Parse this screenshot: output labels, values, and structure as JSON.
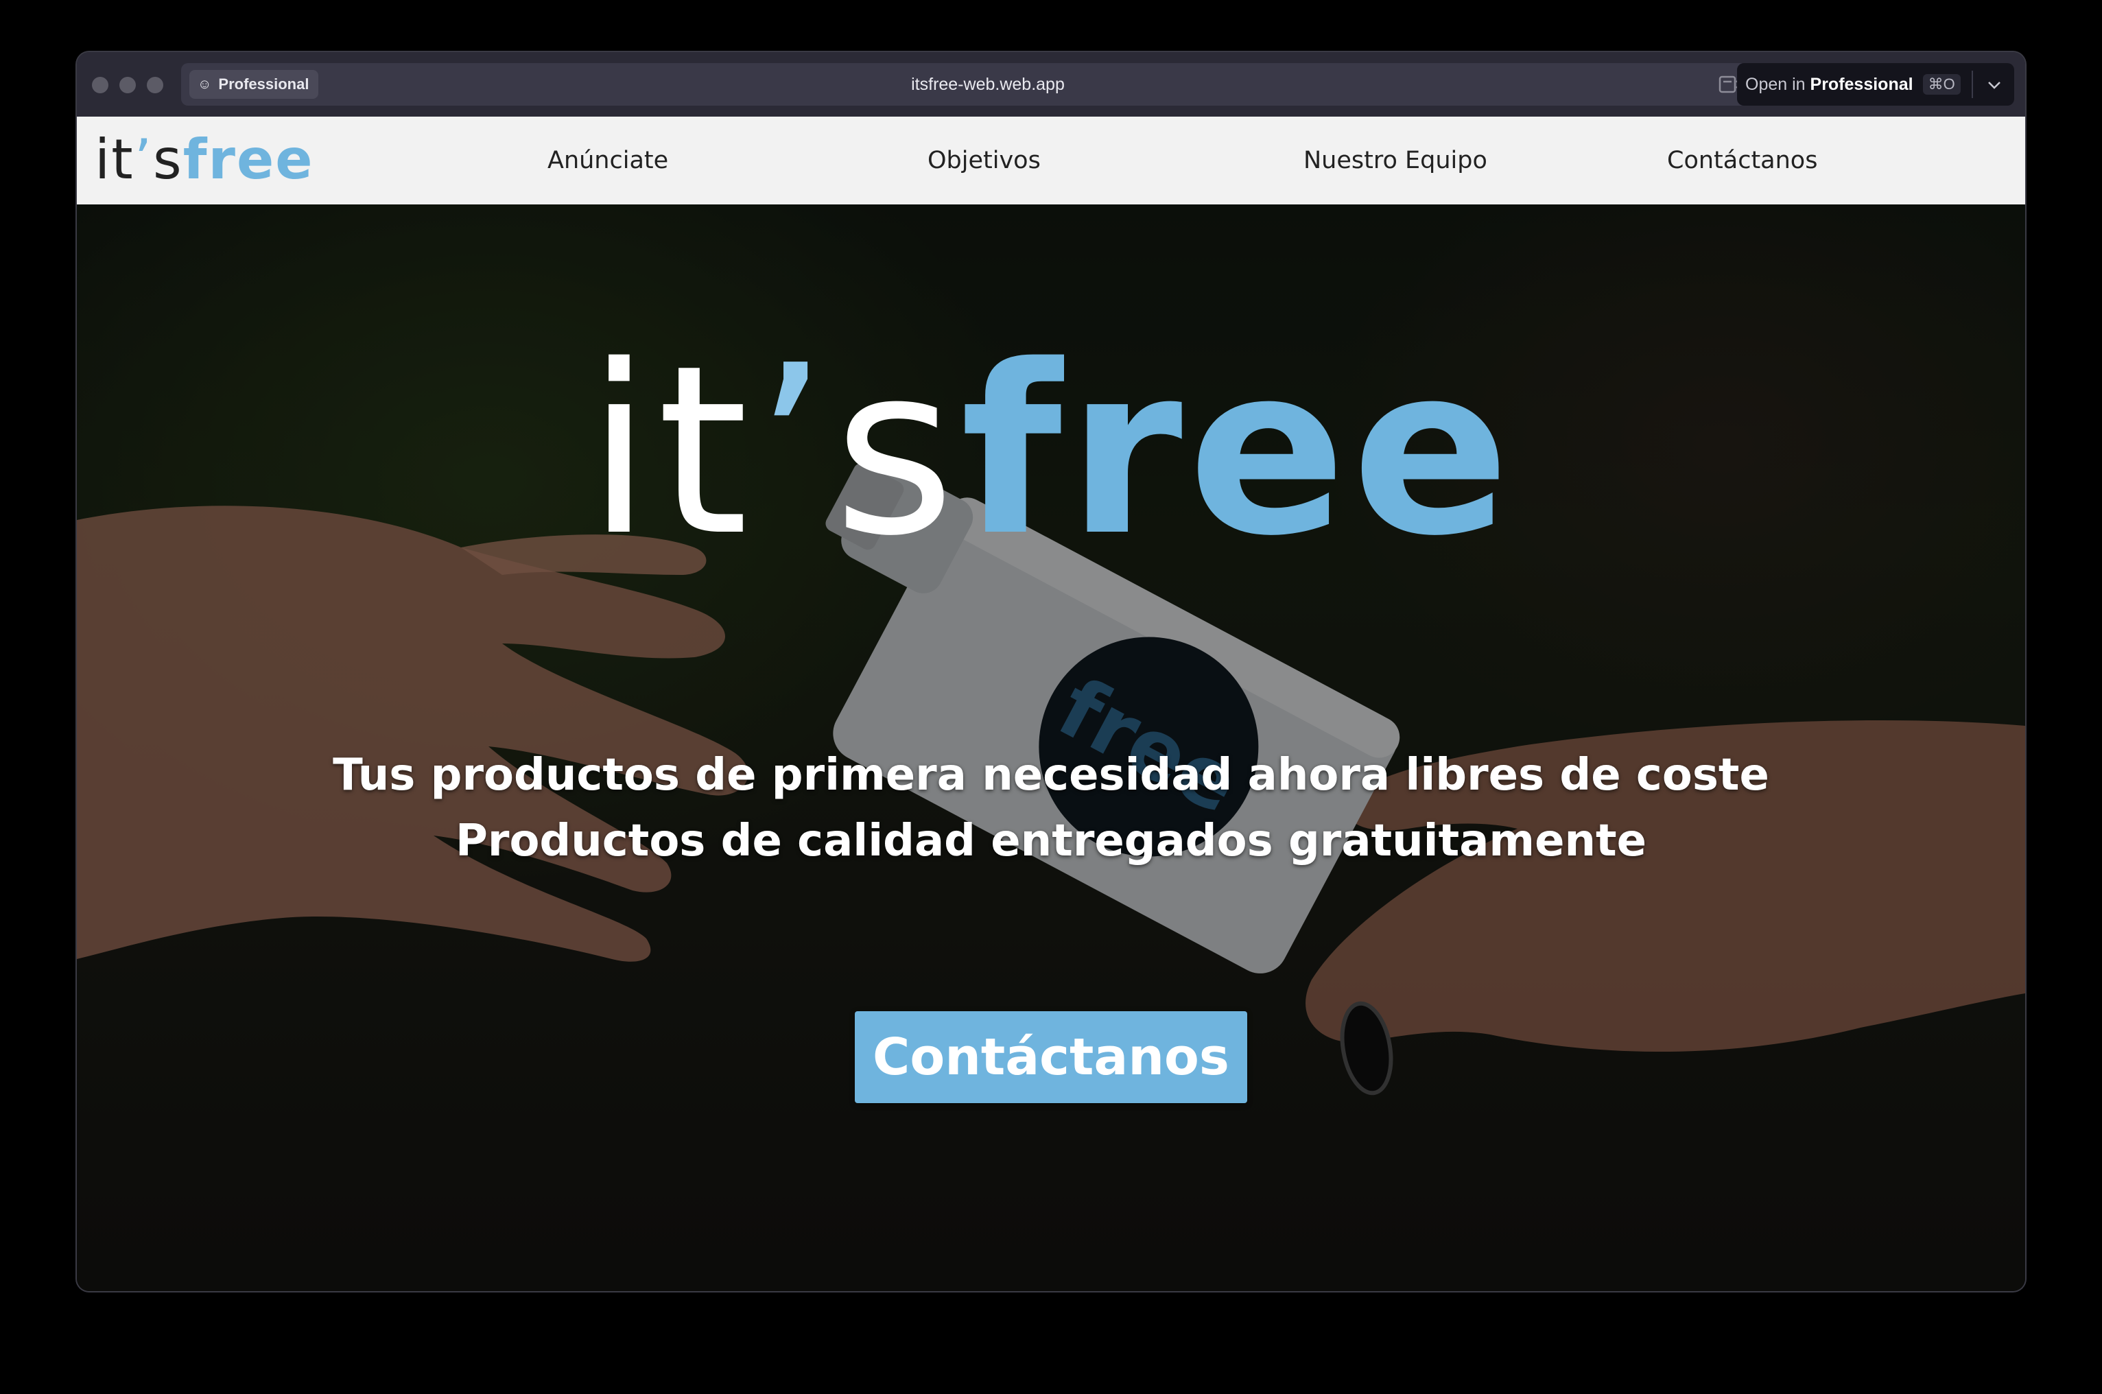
{
  "browser": {
    "profile_label": "Professional",
    "url": "itsfree-web.web.app",
    "open_in_prefix": "Open in",
    "open_in_target": "Professional",
    "open_in_shortcut": "⌘O",
    "icons": [
      "window-controls",
      "profile-face-icon",
      "reader-mode-icon",
      "link-icon",
      "chevron-down-icon"
    ]
  },
  "site": {
    "logo": {
      "part_its": "it",
      "part_apostrophe": "’",
      "part_s": "s",
      "part_free": "free"
    },
    "nav": [
      {
        "label": "Anúnciate"
      },
      {
        "label": "Objetivos"
      },
      {
        "label": "Nuestro Equipo"
      },
      {
        "label": "Contáctanos"
      }
    ],
    "hero": {
      "tagline_line1": "Tus productos de primera necesidad ahora libres de coste",
      "tagline_line2": "Productos de calidad entregados gratuitamente",
      "cta_label": "Contáctanos",
      "bottle_label": "free"
    }
  },
  "colors": {
    "brand_blue": "#6fb4de",
    "nav_bg": "#f2f2f2",
    "chrome_bg": "#2b2a36"
  }
}
